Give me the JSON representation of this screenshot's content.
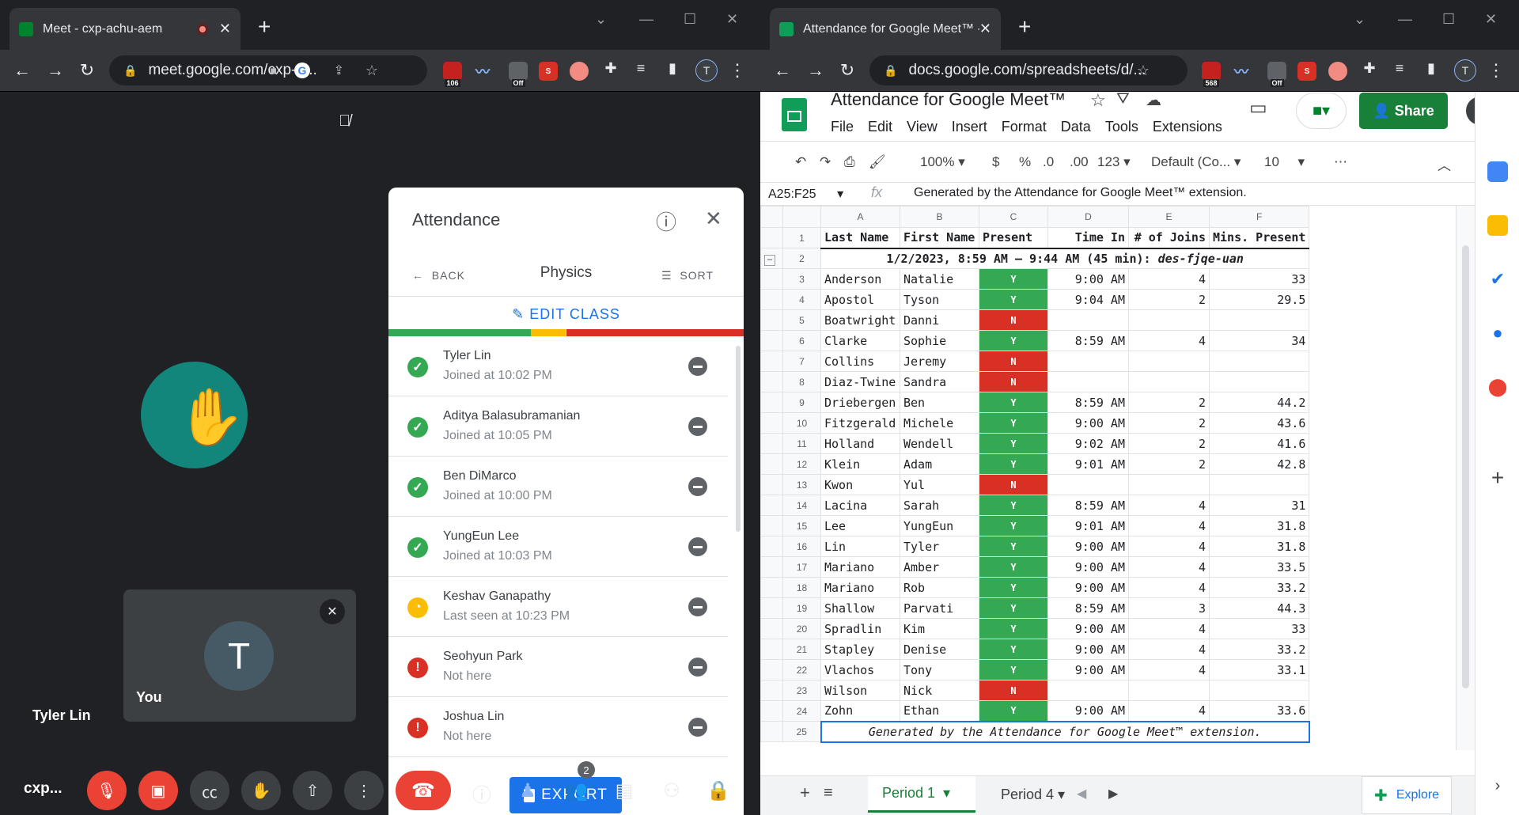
{
  "left_window": {
    "tab_title": "Meet - cxp-achu-aem",
    "url": "meet.google.com/cxp-a...",
    "ext_badges": [
      "106",
      "Off"
    ]
  },
  "meet": {
    "participant_tile_name": "Tyler Lin",
    "self_tile_label": "You",
    "self_avatar_letter": "T",
    "meeting_code_short": "cxp...",
    "people_badge": "2"
  },
  "attendance": {
    "title": "Attendance",
    "back_label": "BACK",
    "class_name": "Physics",
    "sort_label": "SORT",
    "edit_class_label": "EDIT CLASS",
    "export_label": "EXPORT",
    "status_bar": {
      "green": 0.4,
      "yellow": 0.1,
      "red": 0.5
    },
    "students": [
      {
        "name": "Tyler Lin",
        "status_text": "Joined at 10:02 PM",
        "status": "present"
      },
      {
        "name": "Aditya Balasubramanian",
        "status_text": "Joined at 10:05 PM",
        "status": "present"
      },
      {
        "name": "Ben DiMarco",
        "status_text": "Joined at 10:00 PM",
        "status": "present"
      },
      {
        "name": "YungEun Lee",
        "status_text": "Joined at 10:03 PM",
        "status": "present"
      },
      {
        "name": "Keshav Ganapathy",
        "status_text": "Last seen at 10:23 PM",
        "status": "left"
      },
      {
        "name": "Seohyun Park",
        "status_text": "Not here",
        "status": "absent"
      },
      {
        "name": "Joshua Lin",
        "status_text": "Not here",
        "status": "absent"
      }
    ]
  },
  "right_window": {
    "tab_title": "Attendance for Google Meet™ - ",
    "url": "docs.google.com/spreadsheets/d/...",
    "ext_badges": [
      "568",
      "Off"
    ]
  },
  "sheets": {
    "doc_title": "Attendance for Google Meet™",
    "menus": [
      "File",
      "Edit",
      "View",
      "Insert",
      "Format",
      "Data",
      "Tools",
      "Extensions"
    ],
    "share_label": "Share",
    "account_letter": "T",
    "toolbar": {
      "zoom": "100%",
      "currency": "$",
      "percent": "%",
      "dec_less": ".0",
      "dec_more": ".00",
      "num_format": "123",
      "font": "Default (Co...",
      "font_size": "10"
    },
    "name_box": "A25:F25",
    "fx": "fx",
    "formula_content": "Generated by the Attendance for Google Meet™ extension.",
    "columns": [
      "A",
      "B",
      "C",
      "D",
      "E",
      "F"
    ],
    "headers": [
      "Last Name",
      "First Name",
      "Present",
      "Time In",
      "# of Joins",
      "Mins. Present"
    ],
    "group_row": "1/2/2023, 8:59 AM — 9:44 AM (45 min): ",
    "group_code": "des-fjqe-uan",
    "rows": [
      [
        "Anderson",
        "Natalie",
        "Y",
        "9:00 AM",
        "4",
        "33"
      ],
      [
        "Apostol",
        "Tyson",
        "Y",
        "9:04 AM",
        "2",
        "29.5"
      ],
      [
        "Boatwright",
        "Danni",
        "N",
        "",
        "",
        ""
      ],
      [
        "Clarke",
        "Sophie",
        "Y",
        "8:59 AM",
        "4",
        "34"
      ],
      [
        "Collins",
        "Jeremy",
        "N",
        "",
        "",
        ""
      ],
      [
        "Diaz-Twine",
        "Sandra",
        "N",
        "",
        "",
        ""
      ],
      [
        "Driebergen",
        "Ben",
        "Y",
        "8:59 AM",
        "2",
        "44.2"
      ],
      [
        "Fitzgerald",
        "Michele",
        "Y",
        "9:00 AM",
        "2",
        "43.6"
      ],
      [
        "Holland",
        "Wendell",
        "Y",
        "9:02 AM",
        "2",
        "41.6"
      ],
      [
        "Klein",
        "Adam",
        "Y",
        "9:01 AM",
        "2",
        "42.8"
      ],
      [
        "Kwon",
        "Yul",
        "N",
        "",
        "",
        ""
      ],
      [
        "Lacina",
        "Sarah",
        "Y",
        "8:59 AM",
        "4",
        "31"
      ],
      [
        "Lee",
        "YungEun",
        "Y",
        "9:01 AM",
        "4",
        "31.8"
      ],
      [
        "Lin",
        "Tyler",
        "Y",
        "9:00 AM",
        "4",
        "31.8"
      ],
      [
        "Mariano",
        "Amber",
        "Y",
        "9:00 AM",
        "4",
        "33.5"
      ],
      [
        "Mariano",
        "Rob",
        "Y",
        "9:00 AM",
        "4",
        "33.2"
      ],
      [
        "Shallow",
        "Parvati",
        "Y",
        "8:59 AM",
        "3",
        "44.3"
      ],
      [
        "Spradlin",
        "Kim",
        "Y",
        "9:00 AM",
        "4",
        "33"
      ],
      [
        "Stapley",
        "Denise",
        "Y",
        "9:00 AM",
        "4",
        "33.2"
      ],
      [
        "Vlachos",
        "Tony",
        "Y",
        "9:00 AM",
        "4",
        "33.1"
      ],
      [
        "Wilson",
        "Nick",
        "N",
        "",
        "",
        ""
      ],
      [
        "Zohn",
        "Ethan",
        "Y",
        "9:00 AM",
        "4",
        "33.6"
      ]
    ],
    "footer_row": "Generated by the Attendance for Google Meet™ extension.",
    "sheet_tabs": [
      "Period 1",
      "Period 4"
    ],
    "explore_label": "Explore"
  }
}
